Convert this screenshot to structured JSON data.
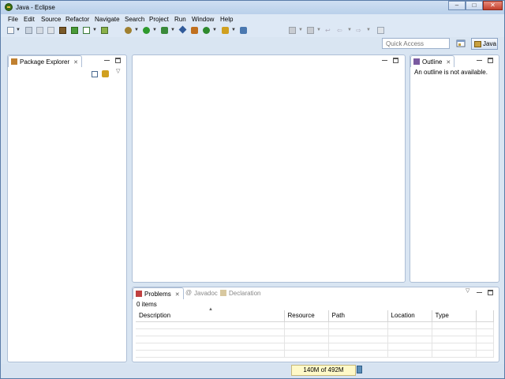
{
  "window": {
    "title": "Java - Eclipse",
    "controls": [
      "–",
      "□",
      "✕"
    ]
  },
  "menu": [
    "File",
    "Edit",
    "Source",
    "Refactor",
    "Navigate",
    "Search",
    "Project",
    "Run",
    "Window",
    "Help"
  ],
  "quick_access": {
    "placeholder": "Quick Access"
  },
  "perspective": {
    "label": "Java"
  },
  "package_explorer": {
    "tab": "Package Explorer",
    "close": "✕"
  },
  "outline": {
    "tab": "Outline",
    "close": "✕",
    "message": "An outline is not available."
  },
  "bottom_panel": {
    "tabs": [
      {
        "label": "Problems",
        "close": "✕"
      },
      {
        "label": "Javadoc"
      },
      {
        "label": "Declaration"
      }
    ],
    "count": "0 items",
    "columns": [
      "Description",
      "Resource",
      "Path",
      "Location",
      "Type"
    ]
  },
  "status": {
    "heap": "140M of 492M"
  }
}
